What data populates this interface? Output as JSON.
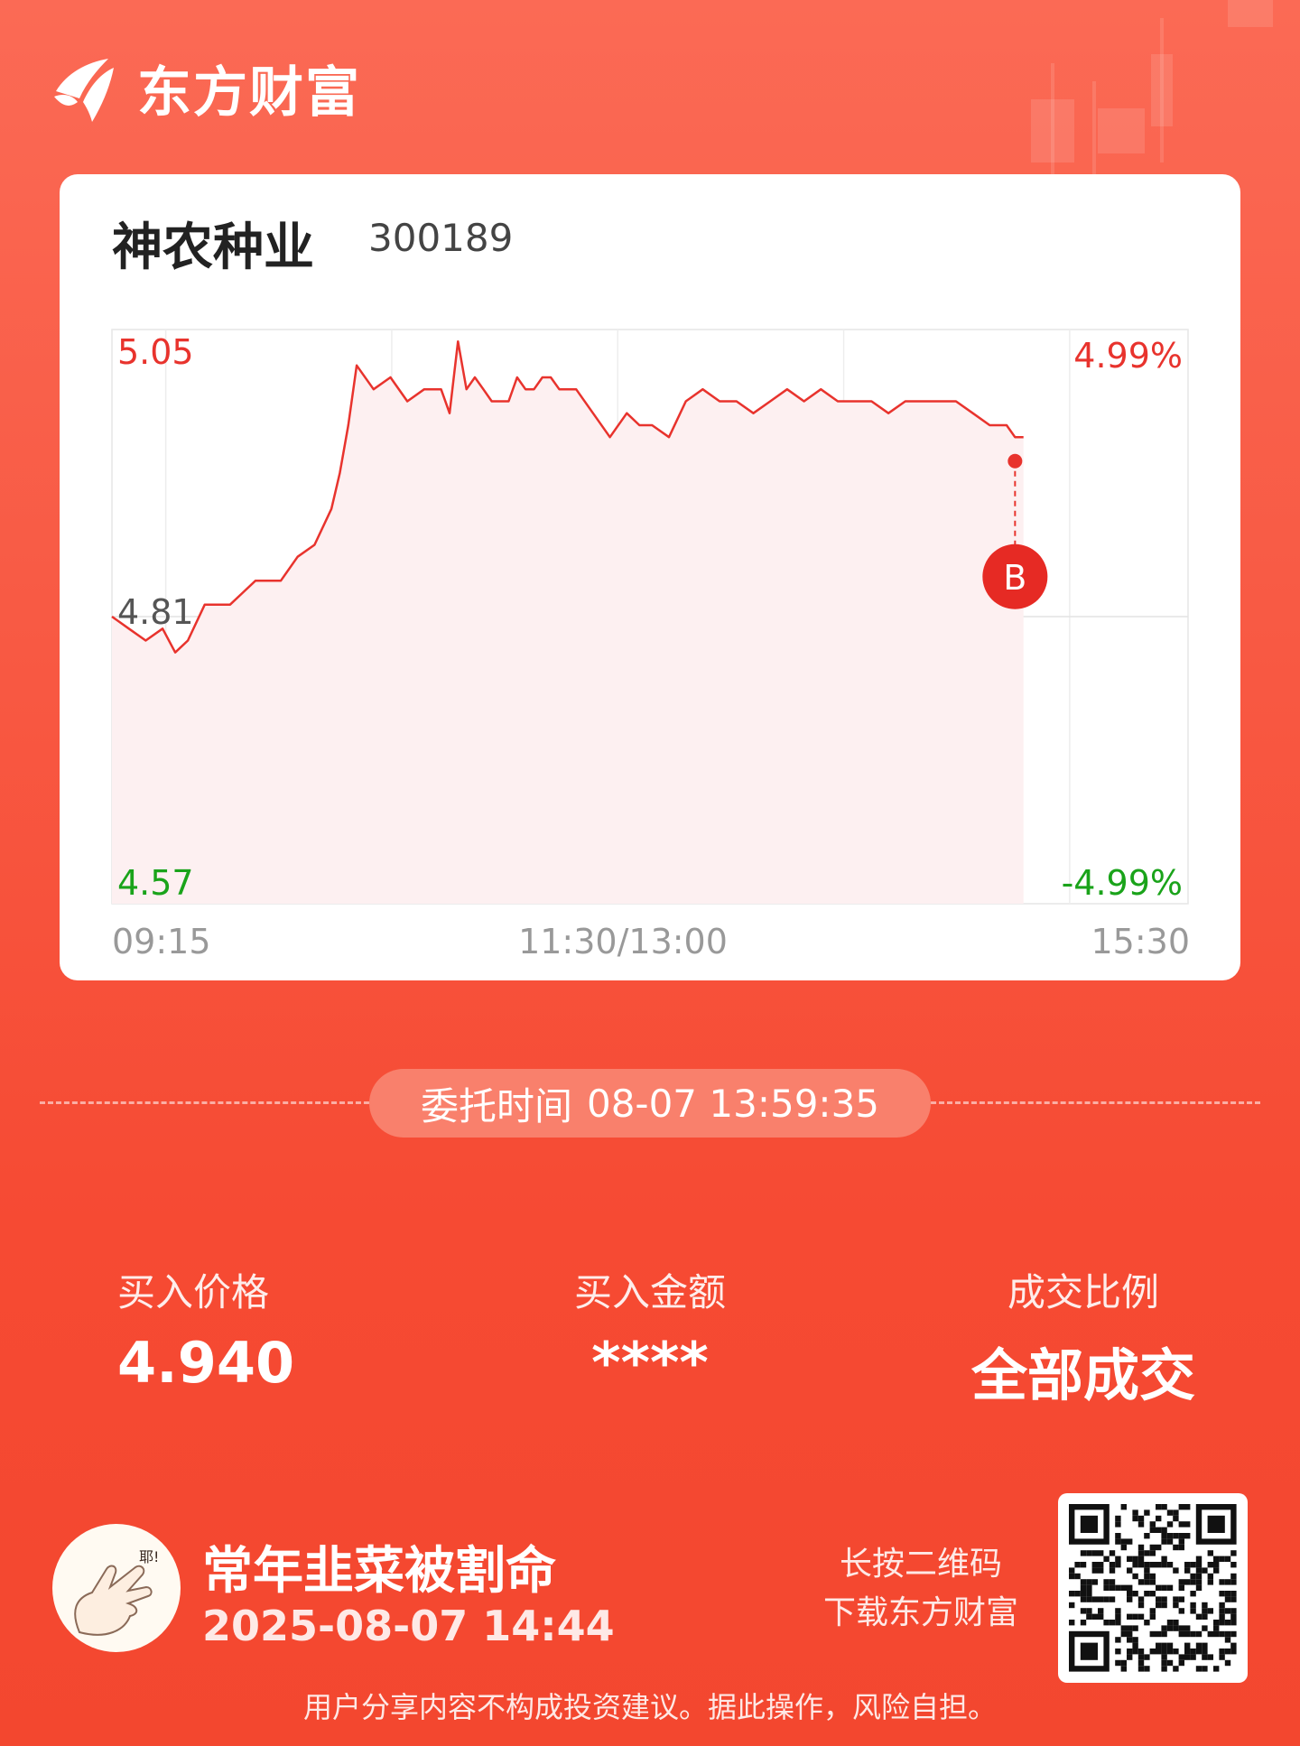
{
  "brand": {
    "name": "东方财富"
  },
  "stock": {
    "name": "神农种业",
    "code": "300189"
  },
  "chart_data": {
    "type": "line",
    "title": "",
    "prev_close": 4.81,
    "y_labels": {
      "high": "5.05",
      "mid": "4.81",
      "low": "4.57"
    },
    "pct_labels": {
      "high": "4.99%",
      "low": "-4.99%"
    },
    "x_labels": [
      "09:15",
      "11:30/13:00",
      "15:30"
    ],
    "ylim": [
      4.57,
      5.05
    ],
    "session_minutes": 255,
    "series": [
      {
        "x": [
          0,
          4,
          8,
          12,
          15,
          18,
          22,
          25,
          28,
          31,
          34,
          37,
          40,
          44,
          48,
          52,
          54,
          56,
          58,
          62,
          66,
          70,
          74,
          78,
          80,
          82,
          84,
          86,
          88,
          90,
          92,
          94,
          96,
          98,
          100,
          102,
          104,
          106,
          110,
          114,
          118,
          122,
          125,
          128,
          132,
          136,
          140,
          144,
          148,
          152,
          156,
          160,
          164,
          168,
          172,
          176,
          180,
          184,
          188,
          192,
          196,
          200,
          204,
          208,
          212,
          214,
          216
        ],
        "values": [
          4.81,
          4.8,
          4.79,
          4.8,
          4.78,
          4.79,
          4.82,
          4.82,
          4.82,
          4.83,
          4.84,
          4.84,
          4.84,
          4.86,
          4.87,
          4.9,
          4.93,
          4.97,
          5.02,
          5.0,
          5.01,
          4.99,
          5.0,
          5.0,
          4.98,
          5.04,
          5.0,
          5.01,
          5.0,
          4.99,
          4.99,
          4.99,
          5.01,
          5.0,
          5.0,
          5.01,
          5.01,
          5.0,
          5.0,
          4.98,
          4.96,
          4.98,
          4.97,
          4.97,
          4.96,
          4.99,
          5.0,
          4.99,
          4.99,
          4.98,
          4.99,
          5.0,
          4.99,
          5.0,
          4.99,
          4.99,
          4.99,
          4.98,
          4.99,
          4.99,
          4.99,
          4.99,
          4.98,
          4.97,
          4.97,
          4.96,
          4.96
        ]
      }
    ],
    "buy_marker": {
      "label": "B",
      "x": 214,
      "price": 4.94
    }
  },
  "order": {
    "label": "委托时间",
    "time": "08-07 13:59:35"
  },
  "stats": [
    {
      "label": "买入价格",
      "value": "4.940"
    },
    {
      "label": "买入金额",
      "value": "****"
    },
    {
      "label": "成交比例",
      "value": "全部成交"
    }
  ],
  "user": {
    "name": "常年韭菜被割命",
    "time": "2025-08-07 14:44"
  },
  "qr": {
    "line1": "长按二维码",
    "line2": "下载东方财富"
  },
  "footer": {
    "disclaimer": "用户分享内容不构成投资建议。据此操作，风险自担。"
  },
  "colors": {
    "up": "#e8332d",
    "down": "#1aa31a",
    "fill": "#fdf0f1"
  }
}
